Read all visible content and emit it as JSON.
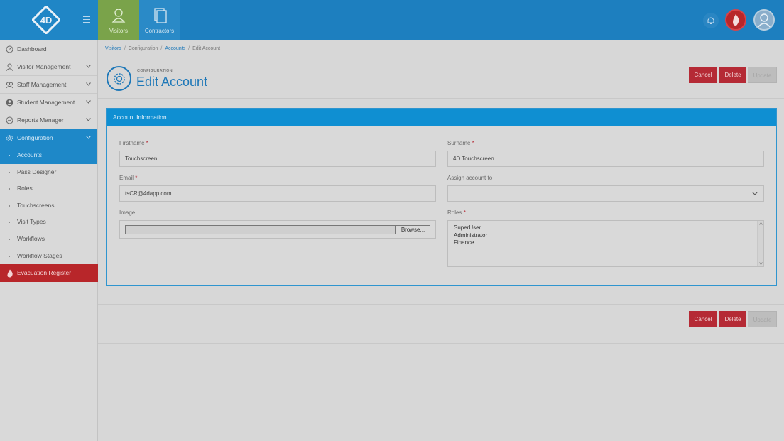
{
  "topnav": {
    "visitors_label": "Visitors",
    "contractors_label": "Contractors"
  },
  "sidebar": {
    "items": [
      {
        "label": "Dashboard"
      },
      {
        "label": "Visitor Management"
      },
      {
        "label": "Staff Management"
      },
      {
        "label": "Student Management"
      },
      {
        "label": "Reports Manager"
      },
      {
        "label": "Configuration"
      }
    ],
    "subitems": [
      {
        "label": "Accounts"
      },
      {
        "label": "Pass Designer"
      },
      {
        "label": "Roles"
      },
      {
        "label": "Touchscreens"
      },
      {
        "label": "Visit Types"
      },
      {
        "label": "Workflows"
      },
      {
        "label": "Workflow Stages"
      }
    ],
    "evacuation_label": "Evacuation Register"
  },
  "breadcrumb": {
    "items": [
      "Visitors",
      "Configuration",
      "Accounts",
      "Edit Account"
    ]
  },
  "header": {
    "kicker": "CONFIGURATION",
    "title": "Edit Account"
  },
  "actions": {
    "cancel": "Cancel",
    "delete": "Delete",
    "update": "Update"
  },
  "panel": {
    "title": "Account Information",
    "firstname_label": "Firstname",
    "firstname_value": "Touchscreen",
    "surname_label": "Surname",
    "surname_value": "4D Touchscreen",
    "email_label": "Email",
    "email_value": "tsCR@4dapp.com",
    "assign_label": "Assign account to",
    "assign_value": "",
    "image_label": "Image",
    "browse_label": "Browse...",
    "roles_label": "Roles",
    "roles": [
      "SuperUser",
      "Administrator",
      "Finance"
    ],
    "required_mark": "*"
  },
  "colors": {
    "topbar": "#1d7fbf",
    "accent": "#1e88c8",
    "danger": "#b52a35",
    "visitors_tab": "#7aa34a"
  }
}
